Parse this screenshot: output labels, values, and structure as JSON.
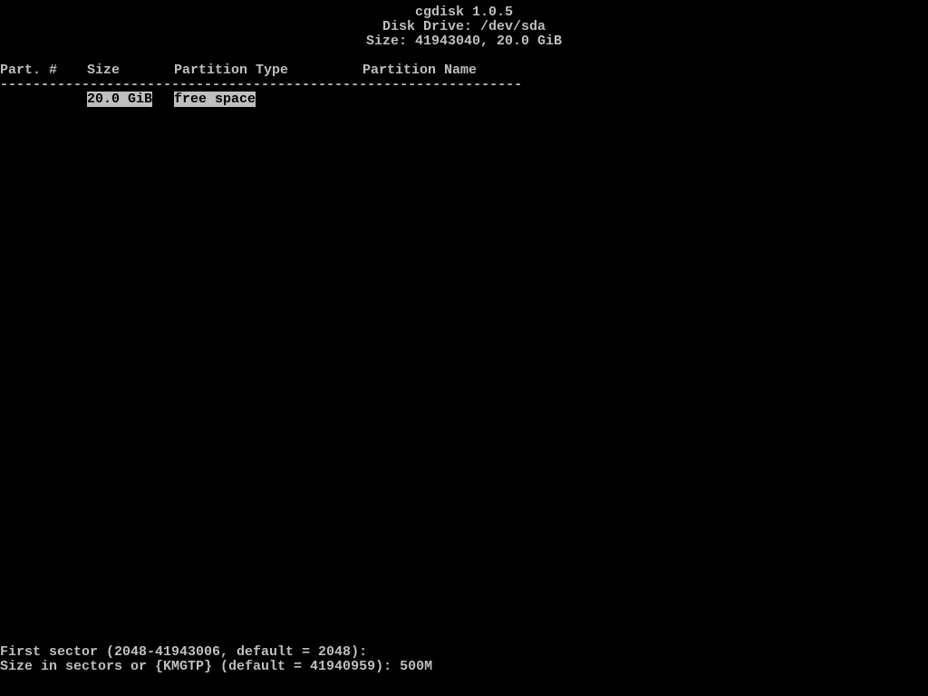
{
  "header": {
    "title": "cgdisk 1.0.5",
    "disk_drive_label": "Disk Drive:",
    "disk_drive_value": "/dev/sda",
    "size_label": "Size:",
    "size_value": "41943040, 20.0 GiB"
  },
  "columns": {
    "part": "Part. #",
    "size": "Size",
    "type": "Partition Type",
    "name": "Partition Name"
  },
  "rows": [
    {
      "part": "",
      "size": "20.0 GiB",
      "type": "free space",
      "name": "",
      "selected": true
    }
  ],
  "prompts": {
    "first_sector": "First sector (2048-41943006, default = 2048): ",
    "size_prompt": "Size in sectors or {KMGTP} (default = 41940959): ",
    "size_input": "500M"
  },
  "divider": "----------------------------------------------------------------"
}
